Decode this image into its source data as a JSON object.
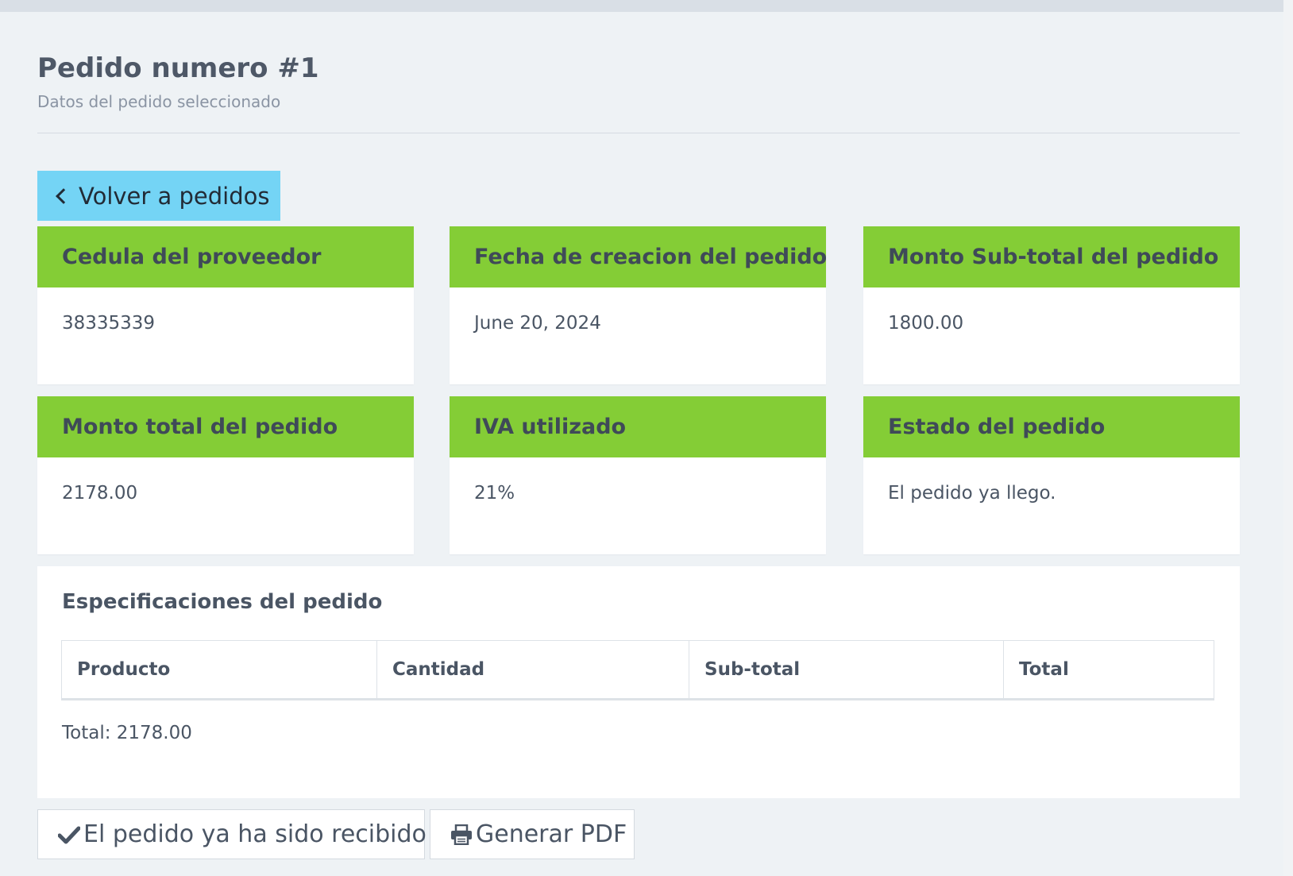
{
  "header": {
    "title": "Pedido numero #1",
    "subtitle": "Datos del pedido seleccionado"
  },
  "back_button": {
    "label": "Volver a pedidos",
    "icon": "chevron-left-icon"
  },
  "cards": [
    {
      "label": "Cedula del proveedor",
      "value": "38335339"
    },
    {
      "label": "Fecha de creacion del pedido",
      "value": "June 20, 2024"
    },
    {
      "label": "Monto Sub-total del pedido",
      "value": "1800.00"
    },
    {
      "label": "Monto total del pedido",
      "value": "2178.00"
    },
    {
      "label": "IVA utilizado",
      "value": "21%"
    },
    {
      "label": "Estado del pedido",
      "value": "El pedido ya llego."
    }
  ],
  "specs": {
    "title": "Especificaciones del pedido",
    "columns": [
      "Producto",
      "Cantidad",
      "Sub-total",
      "Total"
    ],
    "rows": [],
    "total_text": "Total: 2178.00"
  },
  "actions": {
    "received_label": "El pedido ya ha sido recibido",
    "received_icon": "check-icon",
    "pdf_label": "Generar PDF",
    "pdf_icon": "printer-icon"
  },
  "colors": {
    "card_header": "#84cd36",
    "back_button": "#74d4f5",
    "background": "#eef2f5"
  }
}
